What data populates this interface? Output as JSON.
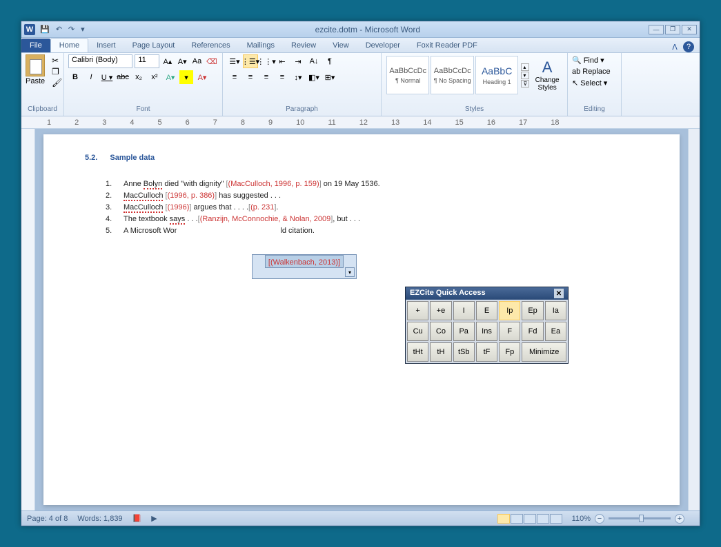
{
  "titlebar": {
    "title": "ezcite.dotm  -  Microsoft Word"
  },
  "tabs": {
    "file": "File",
    "home": "Home",
    "insert": "Insert",
    "pagelayout": "Page Layout",
    "references": "References",
    "mailings": "Mailings",
    "review": "Review",
    "view": "View",
    "developer": "Developer",
    "foxit": "Foxit Reader PDF"
  },
  "ribbon": {
    "clipboard": {
      "paste": "Paste",
      "label": "Clipboard"
    },
    "font": {
      "name": "Calibri (Body)",
      "size": "11",
      "label": "Font"
    },
    "paragraph": {
      "label": "Paragraph"
    },
    "styles": {
      "normal": "¶ Normal",
      "nospacing": "¶ No Spacing",
      "heading1": "Heading 1",
      "prev": "AaBbCcDc",
      "prevh": "AaBbC",
      "change": "Change Styles",
      "label": "Styles"
    },
    "editing": {
      "find": "Find",
      "replace": "Replace",
      "select": "Select",
      "label": "Editing"
    }
  },
  "doc": {
    "heading_num": "5.2.",
    "heading": "Sample data",
    "items": [
      {
        "n": "1.",
        "pre": "Anne ",
        "sq": "Bolyn",
        "mid": " died \"with dignity\" ",
        "bl": "[",
        "cite": "(MacCulloch, 1996, p. 159)",
        "br": "]",
        "post": " on 19 May 1536."
      },
      {
        "n": "2.",
        "pre": "",
        "sq": "MacCulloch",
        "mid": " ",
        "bl": "[",
        "cite": "(1996, p. 386)",
        "br": "]",
        "post": " has suggested . . ."
      },
      {
        "n": "3.",
        "pre": "",
        "sq": "MacCulloch",
        "mid": " ",
        "bl": "[",
        "cite": "(1996)",
        "br": "]",
        "mid2": " argues that . . . .",
        "bl2": "[",
        "cite2": "(p. 231",
        "br2": "]",
        "post": "."
      },
      {
        "n": "4.",
        "pre": "The textbook  ",
        "sq": "says",
        "mid": " . . .",
        "bl": "[",
        "cite": "(Ranzijn, McConnochie, & Nolan, 2009",
        "br": "]",
        "post": ", but . . ."
      },
      {
        "n": "5.",
        "pre": "A Microsoft Wor",
        "gap": "",
        "post": "ld citation."
      }
    ],
    "float": {
      "cite": "(Walkenbach, 2013)"
    }
  },
  "ezcite": {
    "title": "EZCite Quick Access",
    "btns": [
      "+",
      "+e",
      "I",
      "E",
      "Ip",
      "Ep",
      "Ia",
      "Cu",
      "Co",
      "Pa",
      "Ins",
      "F",
      "Fd",
      "Ea",
      "tHt",
      "tH",
      "tSb",
      "tF",
      "Fp"
    ],
    "minimize": "Minimize"
  },
  "status": {
    "page": "Page: 4 of 8",
    "words": "Words: 1,839",
    "zoom": "110%"
  }
}
